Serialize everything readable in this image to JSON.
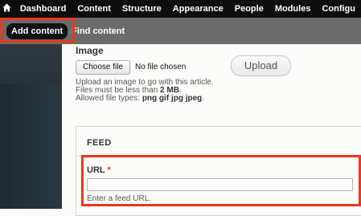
{
  "toolbar": {
    "home_icon": "home-icon",
    "items": [
      "Dashboard",
      "Content",
      "Structure",
      "Appearance",
      "People",
      "Modules",
      "Configu"
    ]
  },
  "shortcuts": {
    "add_content": "Add content",
    "find_content": "Find content"
  },
  "image_field": {
    "label": "Image",
    "choose_button": "Choose file",
    "file_status": "No file chosen",
    "upload_button": "Upload",
    "help_line1": "Upload an image to go with this article.",
    "help_line2_prefix": "Files must be less than ",
    "help_line2_size": "2 MB",
    "help_line2_suffix": ".",
    "help_line3_prefix": "Allowed file types: ",
    "help_line3_types": "png gif jpg jpeg",
    "help_line3_suffix": "."
  },
  "feed": {
    "legend": "FEED",
    "url_label": "URL",
    "required_mark": "*",
    "url_value": "",
    "url_description": "Enter a feed URL."
  },
  "colors": {
    "highlight": "#e8391a",
    "toolbar_bg": "#0d0d0d",
    "shortcuts_bg": "#6b6b6b"
  }
}
